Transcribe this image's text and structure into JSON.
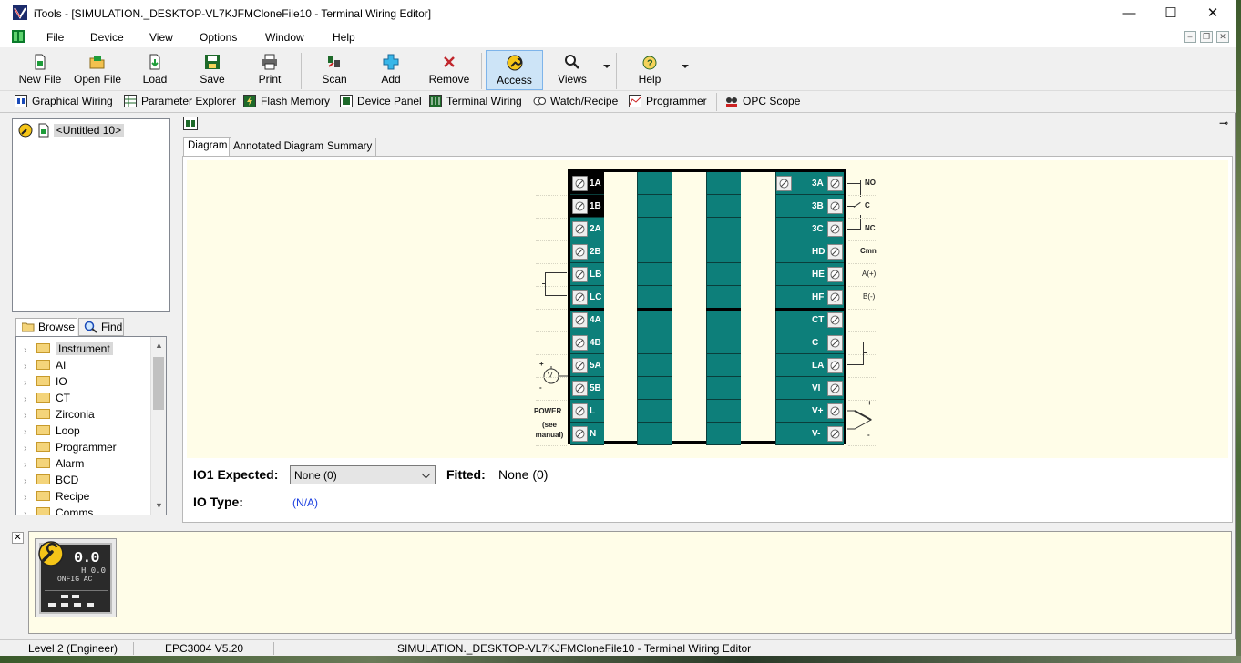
{
  "window": {
    "title": "iTools - [SIMULATION._DESKTOP-VL7KJFMCloneFile10 - Terminal Wiring Editor]",
    "minimize": "—",
    "maximize": "☐",
    "close": "✕"
  },
  "menu": {
    "items": [
      "File",
      "Device",
      "View",
      "Options",
      "Window",
      "Help"
    ],
    "mdi_minimize": "–",
    "mdi_restore": "❐",
    "mdi_close": "✕"
  },
  "toolbar": {
    "buttons": [
      {
        "label": "New File",
        "icon": "new-file-icon"
      },
      {
        "label": "Open File",
        "icon": "open-file-icon"
      },
      {
        "label": "Load",
        "icon": "load-icon"
      },
      {
        "label": "Save",
        "icon": "save-icon"
      },
      {
        "label": "Print",
        "icon": "print-icon"
      },
      {
        "label": "Scan",
        "icon": "scan-icon"
      },
      {
        "label": "Add",
        "icon": "add-icon"
      },
      {
        "label": "Remove",
        "icon": "remove-icon"
      },
      {
        "label": "Access",
        "icon": "access-wrench-icon",
        "active": true
      },
      {
        "label": "Views",
        "icon": "views-magnifier-icon"
      },
      {
        "label": "Help",
        "icon": "help-icon"
      }
    ]
  },
  "toolbar2": {
    "items": [
      "Graphical Wiring",
      "Parameter Explorer",
      "Flash Memory",
      "Device Panel",
      "Terminal Wiring",
      "Watch/Recipe",
      "Programmer",
      "OPC Scope"
    ]
  },
  "tree": {
    "root_label": "<Untitled 10>"
  },
  "left_tabs": {
    "browse": "Browse",
    "find": "Find"
  },
  "browse": {
    "items": [
      "Instrument",
      "AI",
      "IO",
      "CT",
      "Zirconia",
      "Loop",
      "Programmer",
      "Alarm",
      "BCD",
      "Recipe",
      "Comms"
    ]
  },
  "editor_tabs": [
    "Diagram",
    "Annotated Diagram",
    "Summary"
  ],
  "diagram": {
    "left_terminals": [
      "1A",
      "1B",
      "2A",
      "2B",
      "LB",
      "LC",
      "4A",
      "4B",
      "5A",
      "5B",
      "L",
      "N"
    ],
    "right_terminals": [
      "3A",
      "3B",
      "3C",
      "HD",
      "HE",
      "HF",
      "CT",
      "C",
      "LA",
      "VI",
      "V+",
      "V-"
    ],
    "right_labels": {
      "no": "NO",
      "c": "C",
      "nc": "NC",
      "cmn": "Cmn",
      "a": "A(+)",
      "b": "B(-)"
    },
    "power_label": "POWER",
    "power_note": "(see\nmanual)",
    "volt_symbol": "V",
    "plus": "+",
    "minus": "-"
  },
  "form": {
    "io1_label": "IO1 Expected:",
    "io1_value": "None (0)",
    "fitted_label": "Fitted:",
    "fitted_value": "None (0)",
    "iotype_label": "IO Type:",
    "iotype_value": "(N/A)"
  },
  "device": {
    "display_top": "0.0",
    "display_mid": "H 0.0",
    "display_text": "ONFIG AC"
  },
  "status": {
    "level": "Level 2 (Engineer)",
    "model": "EPC3004 V5.20",
    "path": "SIMULATION._DESKTOP-VL7KJFMCloneFile10 - Terminal Wiring Editor"
  },
  "colors": {
    "terminal_teal": "#0d7f7a",
    "diagram_bg": "#fffde8",
    "active_button": "#cde4f7",
    "link_blue": "#1a3ee0"
  }
}
